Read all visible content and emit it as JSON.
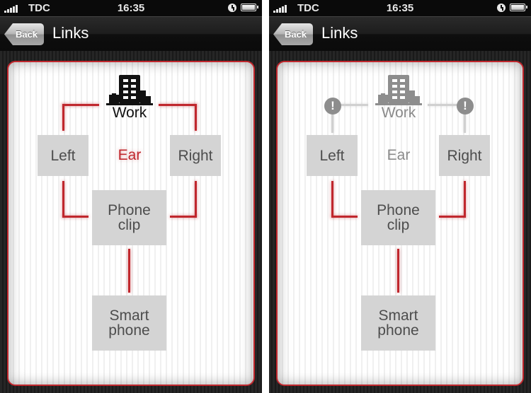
{
  "screens": [
    {
      "status_bar": {
        "carrier": "TDC",
        "time": "16:35",
        "icons": [
          "signal-icon",
          "alarm-icon",
          "battery-icon"
        ]
      },
      "nav": {
        "back_label": "Back",
        "title": "Links"
      },
      "diagram": {
        "state": "work-connected",
        "work_label": "Work",
        "ear_label": "Ear",
        "nodes": {
          "left": "Left",
          "right": "Right",
          "phone_clip": "Phone clip",
          "smartphone": "Smart phone"
        }
      }
    },
    {
      "status_bar": {
        "carrier": "TDC",
        "time": "16:35",
        "icons": [
          "signal-icon",
          "alarm-icon",
          "battery-icon"
        ]
      },
      "nav": {
        "back_label": "Back",
        "title": "Links"
      },
      "diagram": {
        "state": "work-disconnected",
        "work_label": "Work",
        "ear_label": "Ear",
        "warning_glyph": "!",
        "nodes": {
          "left": "Left",
          "right": "Right",
          "phone_clip": "Phone clip",
          "smartphone": "Smart phone"
        }
      }
    }
  ],
  "colors": {
    "accent_red": "#c0272d",
    "node_grey": "#d4d4d4",
    "inactive_grey": "#8a8a8a"
  }
}
